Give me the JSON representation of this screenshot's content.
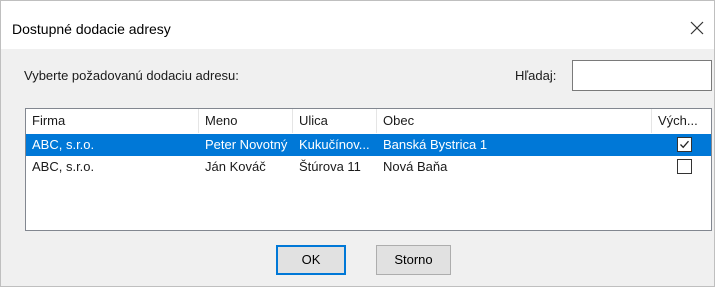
{
  "dialog": {
    "title": "Dostupné dodacie adresy",
    "close_glyph": "close-icon"
  },
  "prompt": "Vyberte požadovanú dodaciu adresu:",
  "search": {
    "label": "Hľadaj:",
    "value": ""
  },
  "table": {
    "columns": [
      "Firma",
      "Meno",
      "Ulica",
      "Obec",
      "Vých..."
    ],
    "rows": [
      {
        "firma": "ABC, s.r.o.",
        "meno": "Peter Novotný",
        "ulica": "Kukučínov...",
        "obec": "Banská Bystrica 1",
        "default": true,
        "selected": true
      },
      {
        "firma": "ABC, s.r.o.",
        "meno": "Ján Kováč",
        "ulica": "Štúrova 11",
        "obec": "Nová Baňa",
        "default": false,
        "selected": false
      }
    ]
  },
  "buttons": {
    "ok": "OK",
    "cancel": "Storno"
  },
  "colors": {
    "selection": "#0078d7",
    "dialog_bg": "#f0f0f0"
  }
}
